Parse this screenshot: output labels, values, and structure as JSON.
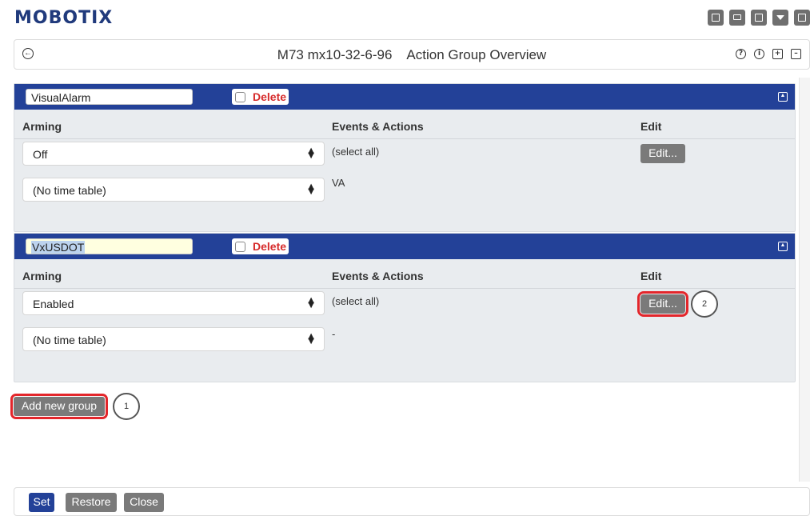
{
  "brand": {
    "logo": "MOBOTIX"
  },
  "window_buttons": [
    "grid-icon",
    "minimize-icon",
    "external-link-icon",
    "dropdown-icon",
    "close-icon"
  ],
  "titlebar": {
    "camera": "M73 mx10-32-6-96",
    "title": "Action Group Overview",
    "icons": [
      "help-icon",
      "info-icon",
      "expand-icon",
      "collapse-icon"
    ]
  },
  "columns": {
    "arming": "Arming",
    "events": "Events & Actions",
    "edit": "Edit"
  },
  "groups": [
    {
      "name": "VisualAlarm",
      "delete_label": "Delete",
      "arming": "Off",
      "time_table": "(No time table)",
      "events_line1": "(select all)",
      "events_line2": "VA",
      "edit_label": "Edit..."
    },
    {
      "name": "VxUSDOT",
      "delete_label": "Delete",
      "arming": "Enabled",
      "time_table": "(No time table)",
      "events_line1": "(select all)",
      "events_line2": "-",
      "edit_label": "Edit...",
      "callout": "2"
    }
  ],
  "add_group": {
    "label": "Add new group",
    "callout": "1"
  },
  "footer": {
    "set": "Set",
    "restore": "Restore",
    "close": "Close"
  },
  "colors": {
    "brand": "#203a7c",
    "panel_header": "#234198",
    "panel_bg": "#e9ecef",
    "button_gray": "#7a7a7a",
    "delete_red": "#d62a2a",
    "highlight_red": "#e3262b"
  }
}
